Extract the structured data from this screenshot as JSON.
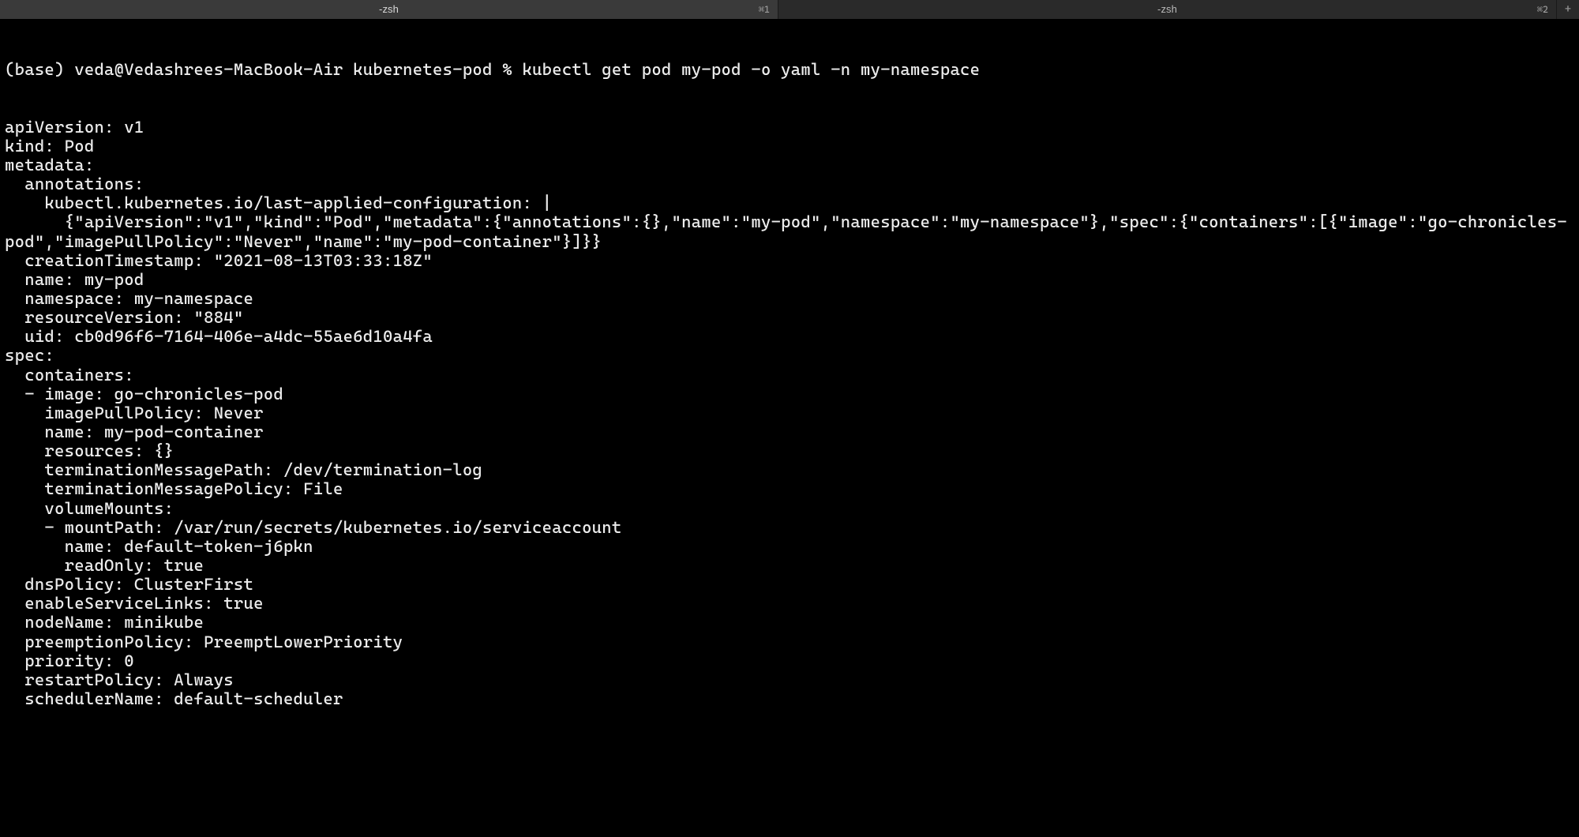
{
  "tabs": [
    {
      "title": "-zsh",
      "shortcut": "⌘1",
      "active": true
    },
    {
      "title": "-zsh",
      "shortcut": "⌘2",
      "active": false
    }
  ],
  "add_tab_glyph": "+",
  "prompt": "(base) veda@Vedashrees-MacBook-Air kubernetes-pod % ",
  "command": "kubectl get pod my-pod -o yaml -n my-namespace",
  "output_lines": [
    "apiVersion: v1",
    "kind: Pod",
    "metadata:",
    "  annotations:",
    "    kubectl.kubernetes.io/last-applied-configuration: |",
    "      {\"apiVersion\":\"v1\",\"kind\":\"Pod\",\"metadata\":{\"annotations\":{},\"name\":\"my-pod\",\"namespace\":\"my-namespace\"},\"spec\":{\"containers\":[{\"image\":\"go-chronicles-pod\",\"imagePullPolicy\":\"Never\",\"name\":\"my-pod-container\"}]}}",
    "  creationTimestamp: \"2021-08-13T03:33:18Z\"",
    "  name: my-pod",
    "  namespace: my-namespace",
    "  resourceVersion: \"884\"",
    "  uid: cb0d96f6-7164-406e-a4dc-55ae6d10a4fa",
    "spec:",
    "  containers:",
    "  - image: go-chronicles-pod",
    "    imagePullPolicy: Never",
    "    name: my-pod-container",
    "    resources: {}",
    "    terminationMessagePath: /dev/termination-log",
    "    terminationMessagePolicy: File",
    "    volumeMounts:",
    "    - mountPath: /var/run/secrets/kubernetes.io/serviceaccount",
    "      name: default-token-j6pkn",
    "      readOnly: true",
    "  dnsPolicy: ClusterFirst",
    "  enableServiceLinks: true",
    "  nodeName: minikube",
    "  preemptionPolicy: PreemptLowerPriority",
    "  priority: 0",
    "  restartPolicy: Always",
    "  schedulerName: default-scheduler"
  ]
}
